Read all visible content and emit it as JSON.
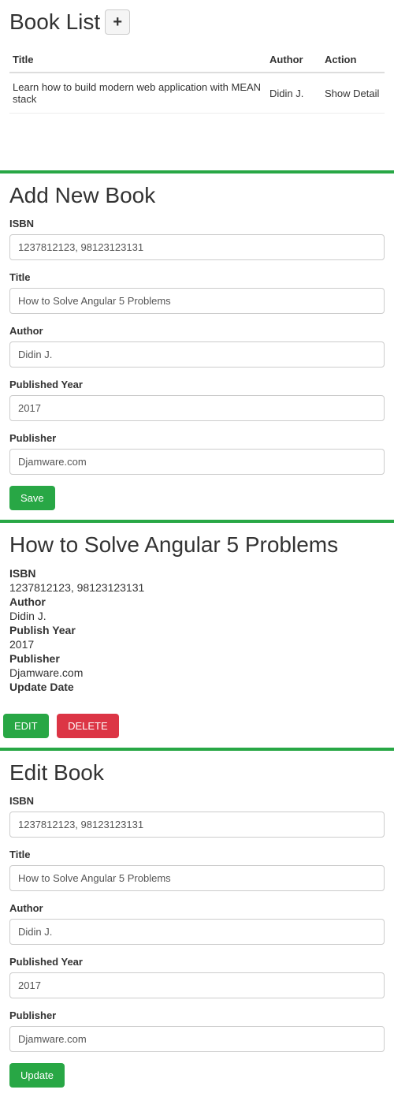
{
  "list": {
    "title": "Book List",
    "add_icon": "+",
    "columns": {
      "title": "Title",
      "author": "Author",
      "action": "Action"
    },
    "rows": [
      {
        "title": "Learn how to build modern web application with MEAN stack",
        "author": "Didin J.",
        "action": "Show Detail"
      }
    ]
  },
  "addForm": {
    "heading": "Add New Book",
    "fields": {
      "isbn": {
        "label": "ISBN",
        "value": "1237812123, 98123123131"
      },
      "title": {
        "label": "Title",
        "value": "How to Solve Angular 5 Problems"
      },
      "author": {
        "label": "Author",
        "value": "Didin J."
      },
      "year": {
        "label": "Published Year",
        "value": "2017"
      },
      "publisher": {
        "label": "Publisher",
        "value": "Djamware.com"
      }
    },
    "save": "Save"
  },
  "detail": {
    "heading": "How to Solve Angular 5 Problems",
    "isbn_label": "ISBN",
    "isbn_value": "1237812123, 98123123131",
    "author_label": "Author",
    "author_value": "Didin J.",
    "year_label": "Publish Year",
    "year_value": "2017",
    "publisher_label": "Publisher",
    "publisher_value": "Djamware.com",
    "update_label": "Update Date",
    "edit_btn": "EDIT",
    "delete_btn": "DELETE"
  },
  "editForm": {
    "heading": "Edit Book",
    "fields": {
      "isbn": {
        "label": "ISBN",
        "value": "1237812123, 98123123131"
      },
      "title": {
        "label": "Title",
        "value": "How to Solve Angular 5 Problems"
      },
      "author": {
        "label": "Author",
        "value": "Didin J."
      },
      "year": {
        "label": "Published Year",
        "value": "2017"
      },
      "publisher": {
        "label": "Publisher",
        "value": "Djamware.com"
      }
    },
    "update": "Update"
  }
}
